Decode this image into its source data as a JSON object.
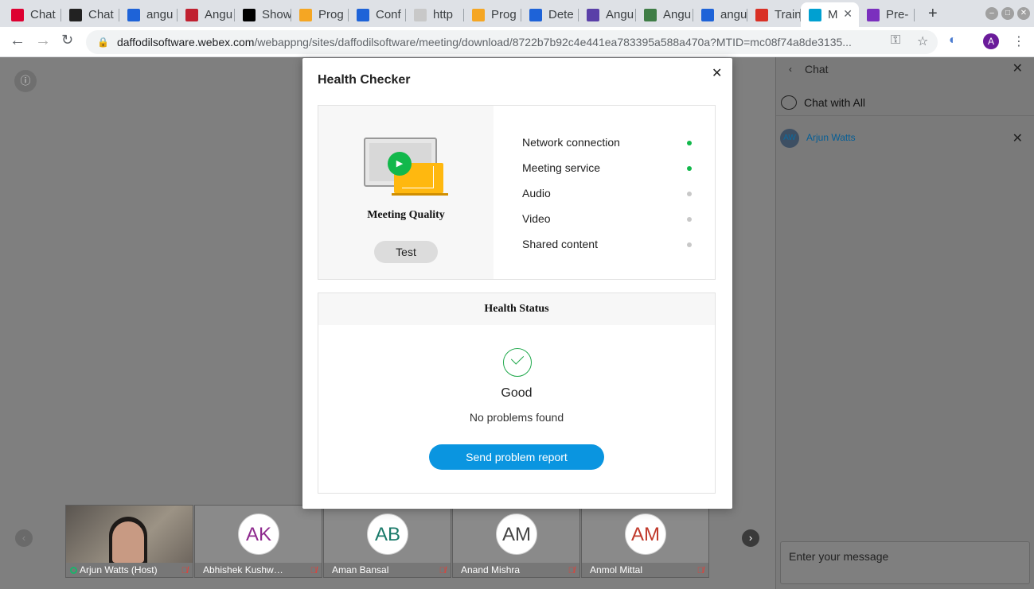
{
  "browser": {
    "tabs": [
      {
        "label": "Chat",
        "favicon": "angular-icon",
        "color": "#dd0031"
      },
      {
        "label": "Chat",
        "favicon": "chat-icon",
        "color": "#222222"
      },
      {
        "label": "angu",
        "favicon": "bolt-icon",
        "color": "#1e63d8"
      },
      {
        "label": "Angu",
        "favicon": "web-icon",
        "color": "#c02030"
      },
      {
        "label": "Show",
        "favicon": "medium-icon",
        "color": "#000000"
      },
      {
        "label": "Prog",
        "favicon": "shield-icon",
        "color": "#f5a623"
      },
      {
        "label": "Conf",
        "favicon": "bolt-icon",
        "color": "#1e63d8"
      },
      {
        "label": "http",
        "favicon": "circle-icon",
        "color": "#c8c8c8"
      },
      {
        "label": "Prog",
        "favicon": "shield-icon",
        "color": "#f5a623"
      },
      {
        "label": "Dete",
        "favicon": "bolt-icon",
        "color": "#1e63d8"
      },
      {
        "label": "Angu",
        "favicon": "react-icon",
        "color": "#5a3fa8"
      },
      {
        "label": "Angu",
        "favicon": "atom-icon",
        "color": "#3f7d46"
      },
      {
        "label": "angu",
        "favicon": "bolt-icon",
        "color": "#1e63d8"
      },
      {
        "label": "Train",
        "favicon": "gmail-icon",
        "color": "#d93025"
      },
      {
        "label": "M",
        "favicon": "webex-icon",
        "color": "#00a0d1"
      },
      {
        "label": "Pre-",
        "favicon": "list-icon",
        "color": "#7b2fbe"
      }
    ],
    "url_host": "daffodilsoftware.webex.com",
    "url_path": "/webappng/sites/daffodilsoftware/meeting/download/8722b7b92c4e441ea783395a588a470a?MTID=mc08f74a8de3135...",
    "profile_initial": "A"
  },
  "modal": {
    "title": "Health Checker",
    "meeting_quality_label": "Meeting Quality",
    "test_button": "Test",
    "checks": [
      {
        "label": "Network connection",
        "status": "ok",
        "color": "#12b84b"
      },
      {
        "label": "Meeting service",
        "status": "ok",
        "color": "#12b84b"
      },
      {
        "label": "Audio",
        "status": "pending",
        "color": "#c8c8c8"
      },
      {
        "label": "Video",
        "status": "pending",
        "color": "#c8c8c8"
      },
      {
        "label": "Shared content",
        "status": "pending",
        "color": "#c8c8c8"
      }
    ],
    "health_status_label": "Health Status",
    "status_text": "Good",
    "status_detail": "No problems found",
    "send_report_button": "Send problem report"
  },
  "participants": [
    {
      "name": "Arjun Watts (Host)",
      "initials": "",
      "video": true
    },
    {
      "name": "Abhishek Kushw…",
      "initials": "AK",
      "color": "#8e2a8e"
    },
    {
      "name": "Aman Bansal",
      "initials": "AB",
      "color": "#1a7a6a"
    },
    {
      "name": "Anand Mishra",
      "initials": "AM",
      "color": "#444444"
    },
    {
      "name": "Anmol Mittal",
      "initials": "AM",
      "color": "#c0392b"
    }
  ],
  "chat": {
    "title": "Chat",
    "chat_with_all": "Chat with All",
    "person_initials": "AW",
    "person_name": "Arjun Watts",
    "message_placeholder": "Enter your message"
  }
}
